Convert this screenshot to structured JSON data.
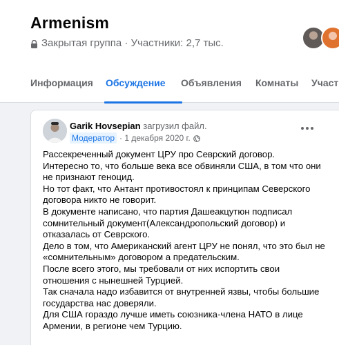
{
  "group": {
    "name": "Armenism",
    "privacy": "Закрытая группа",
    "members": "Участники: 2,7 тыс."
  },
  "tabs": [
    {
      "label": "Информация",
      "active": false
    },
    {
      "label": "Обсуждение",
      "active": true
    },
    {
      "label": "Объявления",
      "active": false
    },
    {
      "label": "Комнаты",
      "active": false
    },
    {
      "label": "Участ",
      "active": false
    }
  ],
  "post": {
    "author": "Garik Hovsepian",
    "action": "загрузил файл.",
    "badge": "Модератор",
    "date": "1 декабря 2020 г.",
    "lines": [
      "Рассекреченный документ ЦРУ про Севрский договор.",
      "Интересно то, что больше века все обвиняли США, в том что они",
      "не признают геноцид.",
      "Но тот факт, что Антант противостоял к принципам Северского",
      "договора никто не говорит.",
      "В документе написано, что партия Дашеакцутюн подписал",
      "сомнительный документ(Александропольский договор) и",
      "отказалась от Севрского.",
      "Дело в том, что Американский агент ЦРУ не понял, что это был не",
      "«сомнительным» договором а предательским.",
      "После всего этого, мы требовали от них испортить свои",
      "отношения с нынешней Турцией.",
      "Так сначала надо избавится от внутренней язвы, чтобы большие",
      "государства нас доверяли.",
      "Для США гораздо лучше иметь союзника-члена НАТО в лице",
      "Армении, в регионе чем Турцию."
    ]
  },
  "colors": {
    "accent": "#1b74e4",
    "secondary_text": "#65676b",
    "page_bg": "#f0f2f5",
    "badge_bg": "#e7f3ff"
  },
  "icons": [
    "lock-icon",
    "globe-icon",
    "more-options-icon"
  ]
}
